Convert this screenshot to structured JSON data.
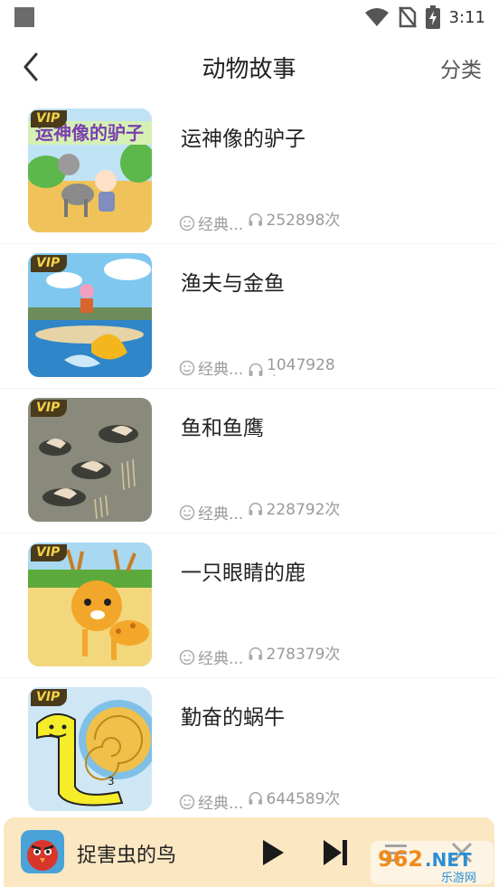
{
  "status_bar": {
    "time": "3:11"
  },
  "header": {
    "title": "动物故事",
    "category_label": "分类"
  },
  "stories": [
    {
      "title": "运神像的驴子",
      "vip": "VIP",
      "category": "经典...",
      "plays": "252898次"
    },
    {
      "title": "渔夫与金鱼",
      "vip": "VIP",
      "category": "经典...",
      "plays": "1047928次"
    },
    {
      "title": "鱼和鱼鹰",
      "vip": "VIP",
      "category": "经典...",
      "plays": "228792次"
    },
    {
      "title": "一只眼睛的鹿",
      "vip": "VIP",
      "category": "经典...",
      "plays": "278379次"
    },
    {
      "title": "勤奋的蜗牛",
      "vip": "VIP",
      "category": "经典...",
      "plays": "644589次"
    }
  ],
  "player": {
    "title": "捉害虫的鸟"
  },
  "watermark": {
    "text": "962.NET",
    "subtext": "乐游网"
  },
  "colors": {
    "player_bg": "#fbe7c2",
    "meta_gray": "#9a9a9a",
    "vip_gold": "#f4d24a"
  }
}
